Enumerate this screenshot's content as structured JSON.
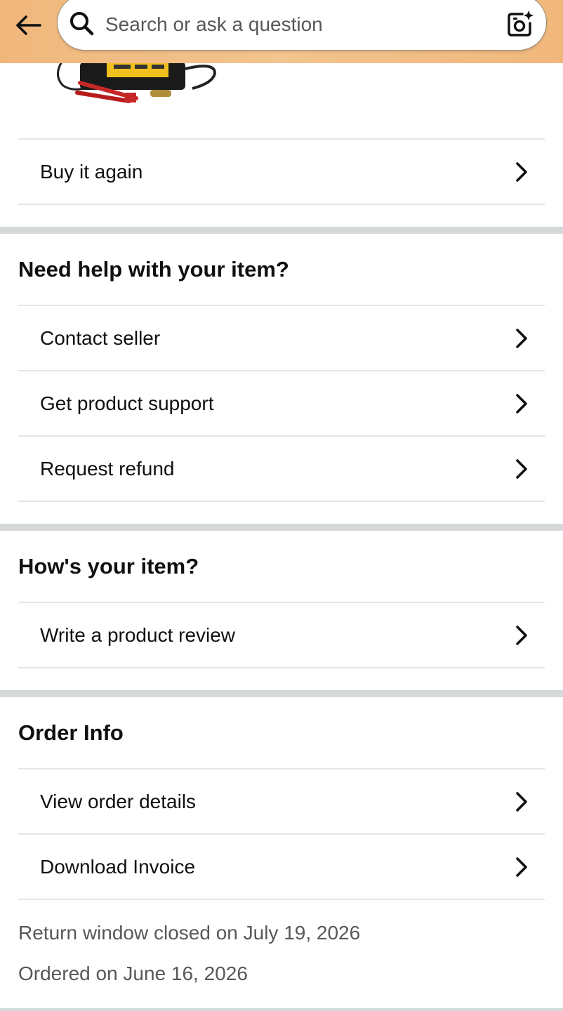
{
  "search": {
    "placeholder": "Search or ask a question"
  },
  "icons": {
    "back": "back-arrow-icon",
    "search": "search-icon",
    "lens": "camera-lens-icon",
    "chevron": "chevron-right-icon"
  },
  "colors": {
    "header_bg": "#f3c48f",
    "section_gap": "#d5d9d9",
    "divider": "#e3e6e6",
    "meta_text": "#565959"
  },
  "buy_again": {
    "label": "Buy it again"
  },
  "help_section": {
    "title": "Need help with your item?",
    "items": [
      {
        "label": "Contact seller"
      },
      {
        "label": "Get product support"
      },
      {
        "label": "Request refund"
      }
    ]
  },
  "review_section": {
    "title": "How's your item?",
    "items": [
      {
        "label": "Write a product review"
      }
    ]
  },
  "order_section": {
    "title": "Order Info",
    "items": [
      {
        "label": "View order details"
      },
      {
        "label": "Download Invoice"
      }
    ],
    "return_window": "Return window closed on July 19, 2026",
    "ordered_on": "Ordered on June 16, 2026"
  }
}
